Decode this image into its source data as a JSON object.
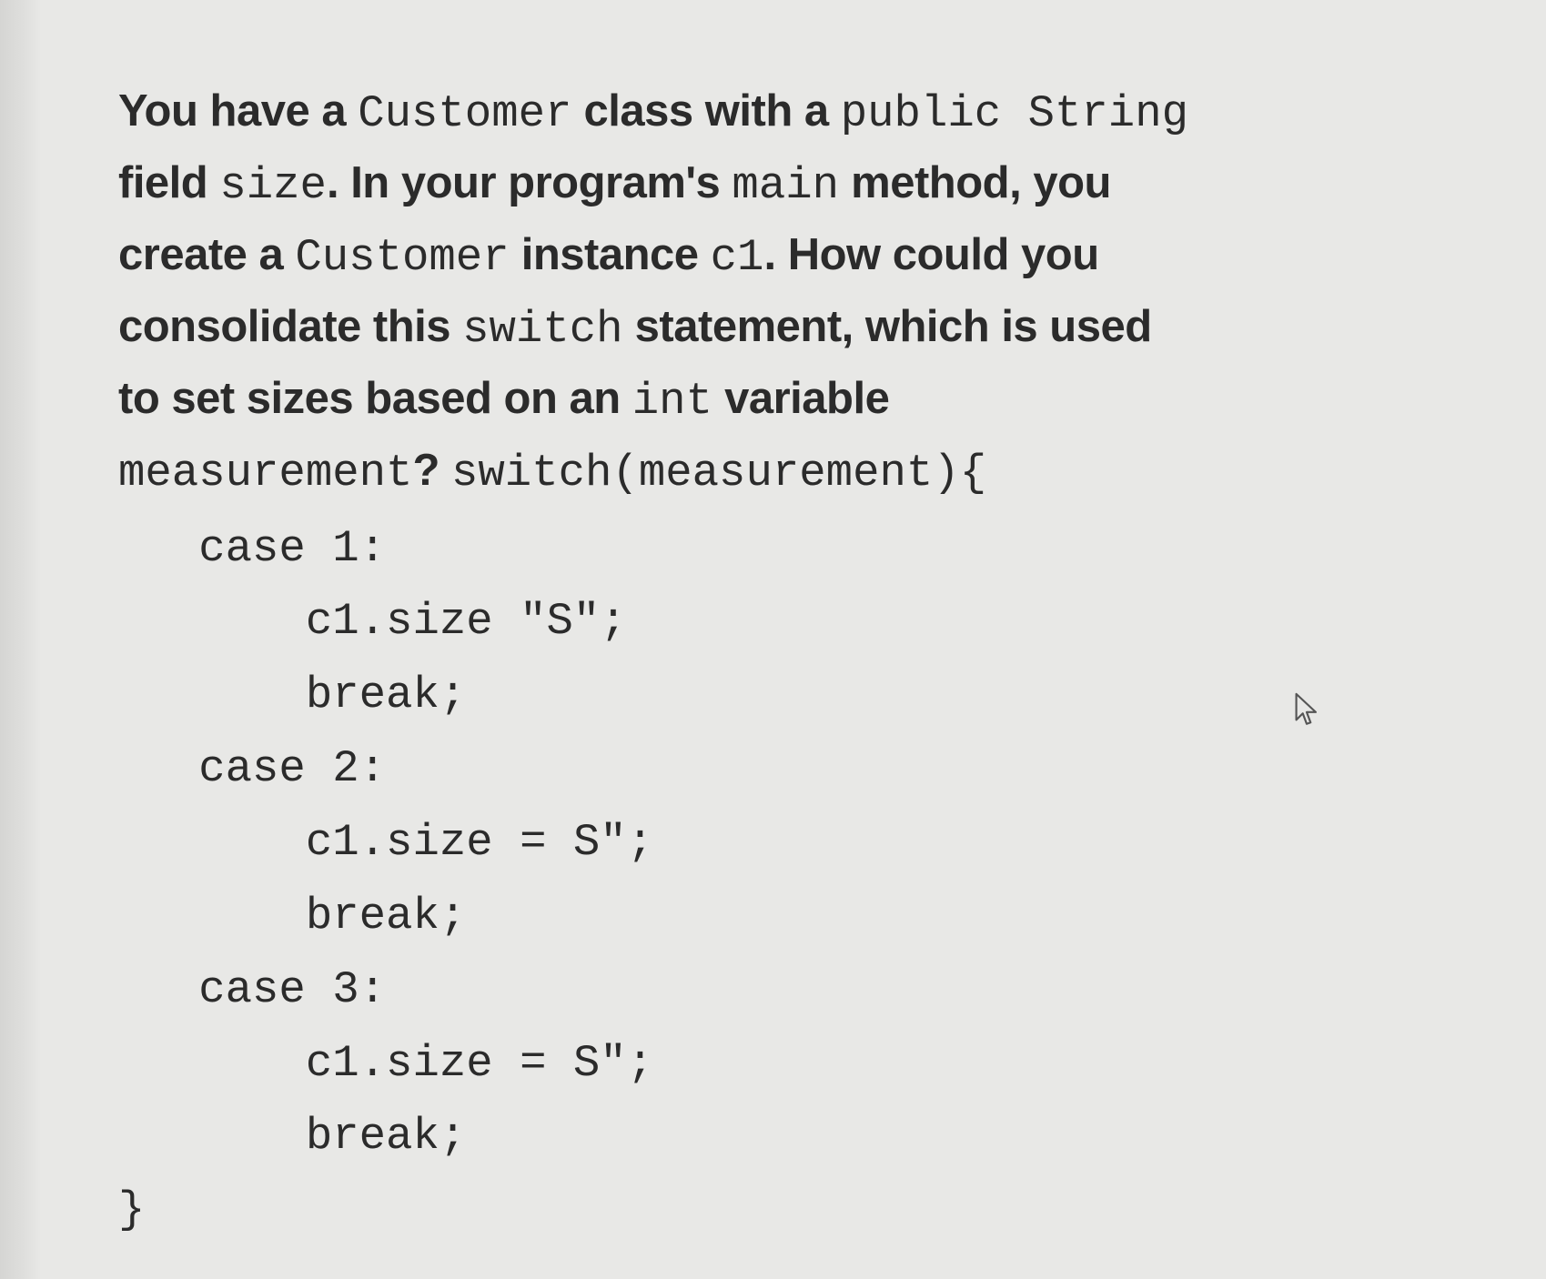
{
  "question": {
    "p1_a": "You have a ",
    "p1_b": "Customer",
    "p1_c": " class with a ",
    "p1_d": "public String",
    "p2_a": "field ",
    "p2_b": "size",
    "p2_c": ". In your program's ",
    "p2_d": "main",
    "p2_e": " method, you",
    "p3_a": "create a ",
    "p3_b": "Customer",
    "p3_c": " instance ",
    "p3_d": "c1",
    "p3_e": ". How could you",
    "p4_a": "consolidate this ",
    "p4_b": "switch",
    "p4_c": " statement, which is used",
    "p5_a": "to set sizes based on an ",
    "p5_b": "int",
    "p5_c": " variable",
    "p6_a": "measurement",
    "p6_b": "? ",
    "p6_c": "switch(measurement){"
  },
  "code": {
    "line1": "   case 1:",
    "line2": "       c1.size \"S\";",
    "line3": "       break;",
    "line4": "   case 2:",
    "line5": "       c1.size = S\";",
    "line6": "       break;",
    "line7": "   case 3:",
    "line8": "       c1.size = S\";",
    "line9": "       break;",
    "line10": "}"
  }
}
